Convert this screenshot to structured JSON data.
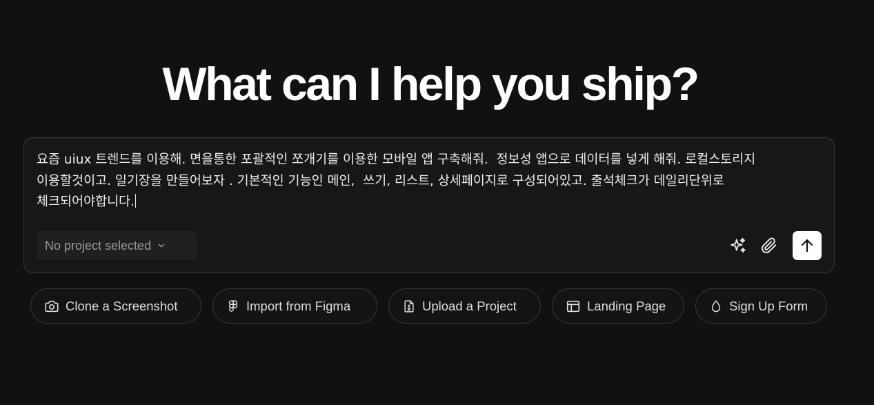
{
  "headline": "What can I help you ship?",
  "composer": {
    "prompt_text": "요즘 uiux 트렌드를 이용해. 면을통한 포괄적인 쪼개기를 이용한 모바일 앱 구축해줘.  정보성 앱으로 데이터를 넣게 해줘. 로컬스토리지 이용할것이고. 일기장을 만들어보자 . 기본적인 기능인 메인,  쓰기, 리스트, 상세페이지로 구성되어있고. 출석체크가 데일리단위로 체크되어야합니다.",
    "project_select": "No project selected",
    "icons": {
      "enhance": "sparkles-icon",
      "attach": "paperclip-icon",
      "send": "arrow-up-icon"
    }
  },
  "chips": [
    {
      "label": "Clone a Screenshot",
      "icon": "camera-icon"
    },
    {
      "label": "Import from Figma",
      "icon": "figma-icon"
    },
    {
      "label": "Upload a Project",
      "icon": "file-upload-icon"
    },
    {
      "label": "Landing Page",
      "icon": "layout-icon"
    },
    {
      "label": "Sign Up Form",
      "icon": "droplet-icon"
    }
  ],
  "colors": {
    "background": "#111111",
    "composer_bg": "#171717",
    "border": "#3a3a3a",
    "text": "#ededed",
    "muted": "#9a9a9a"
  }
}
